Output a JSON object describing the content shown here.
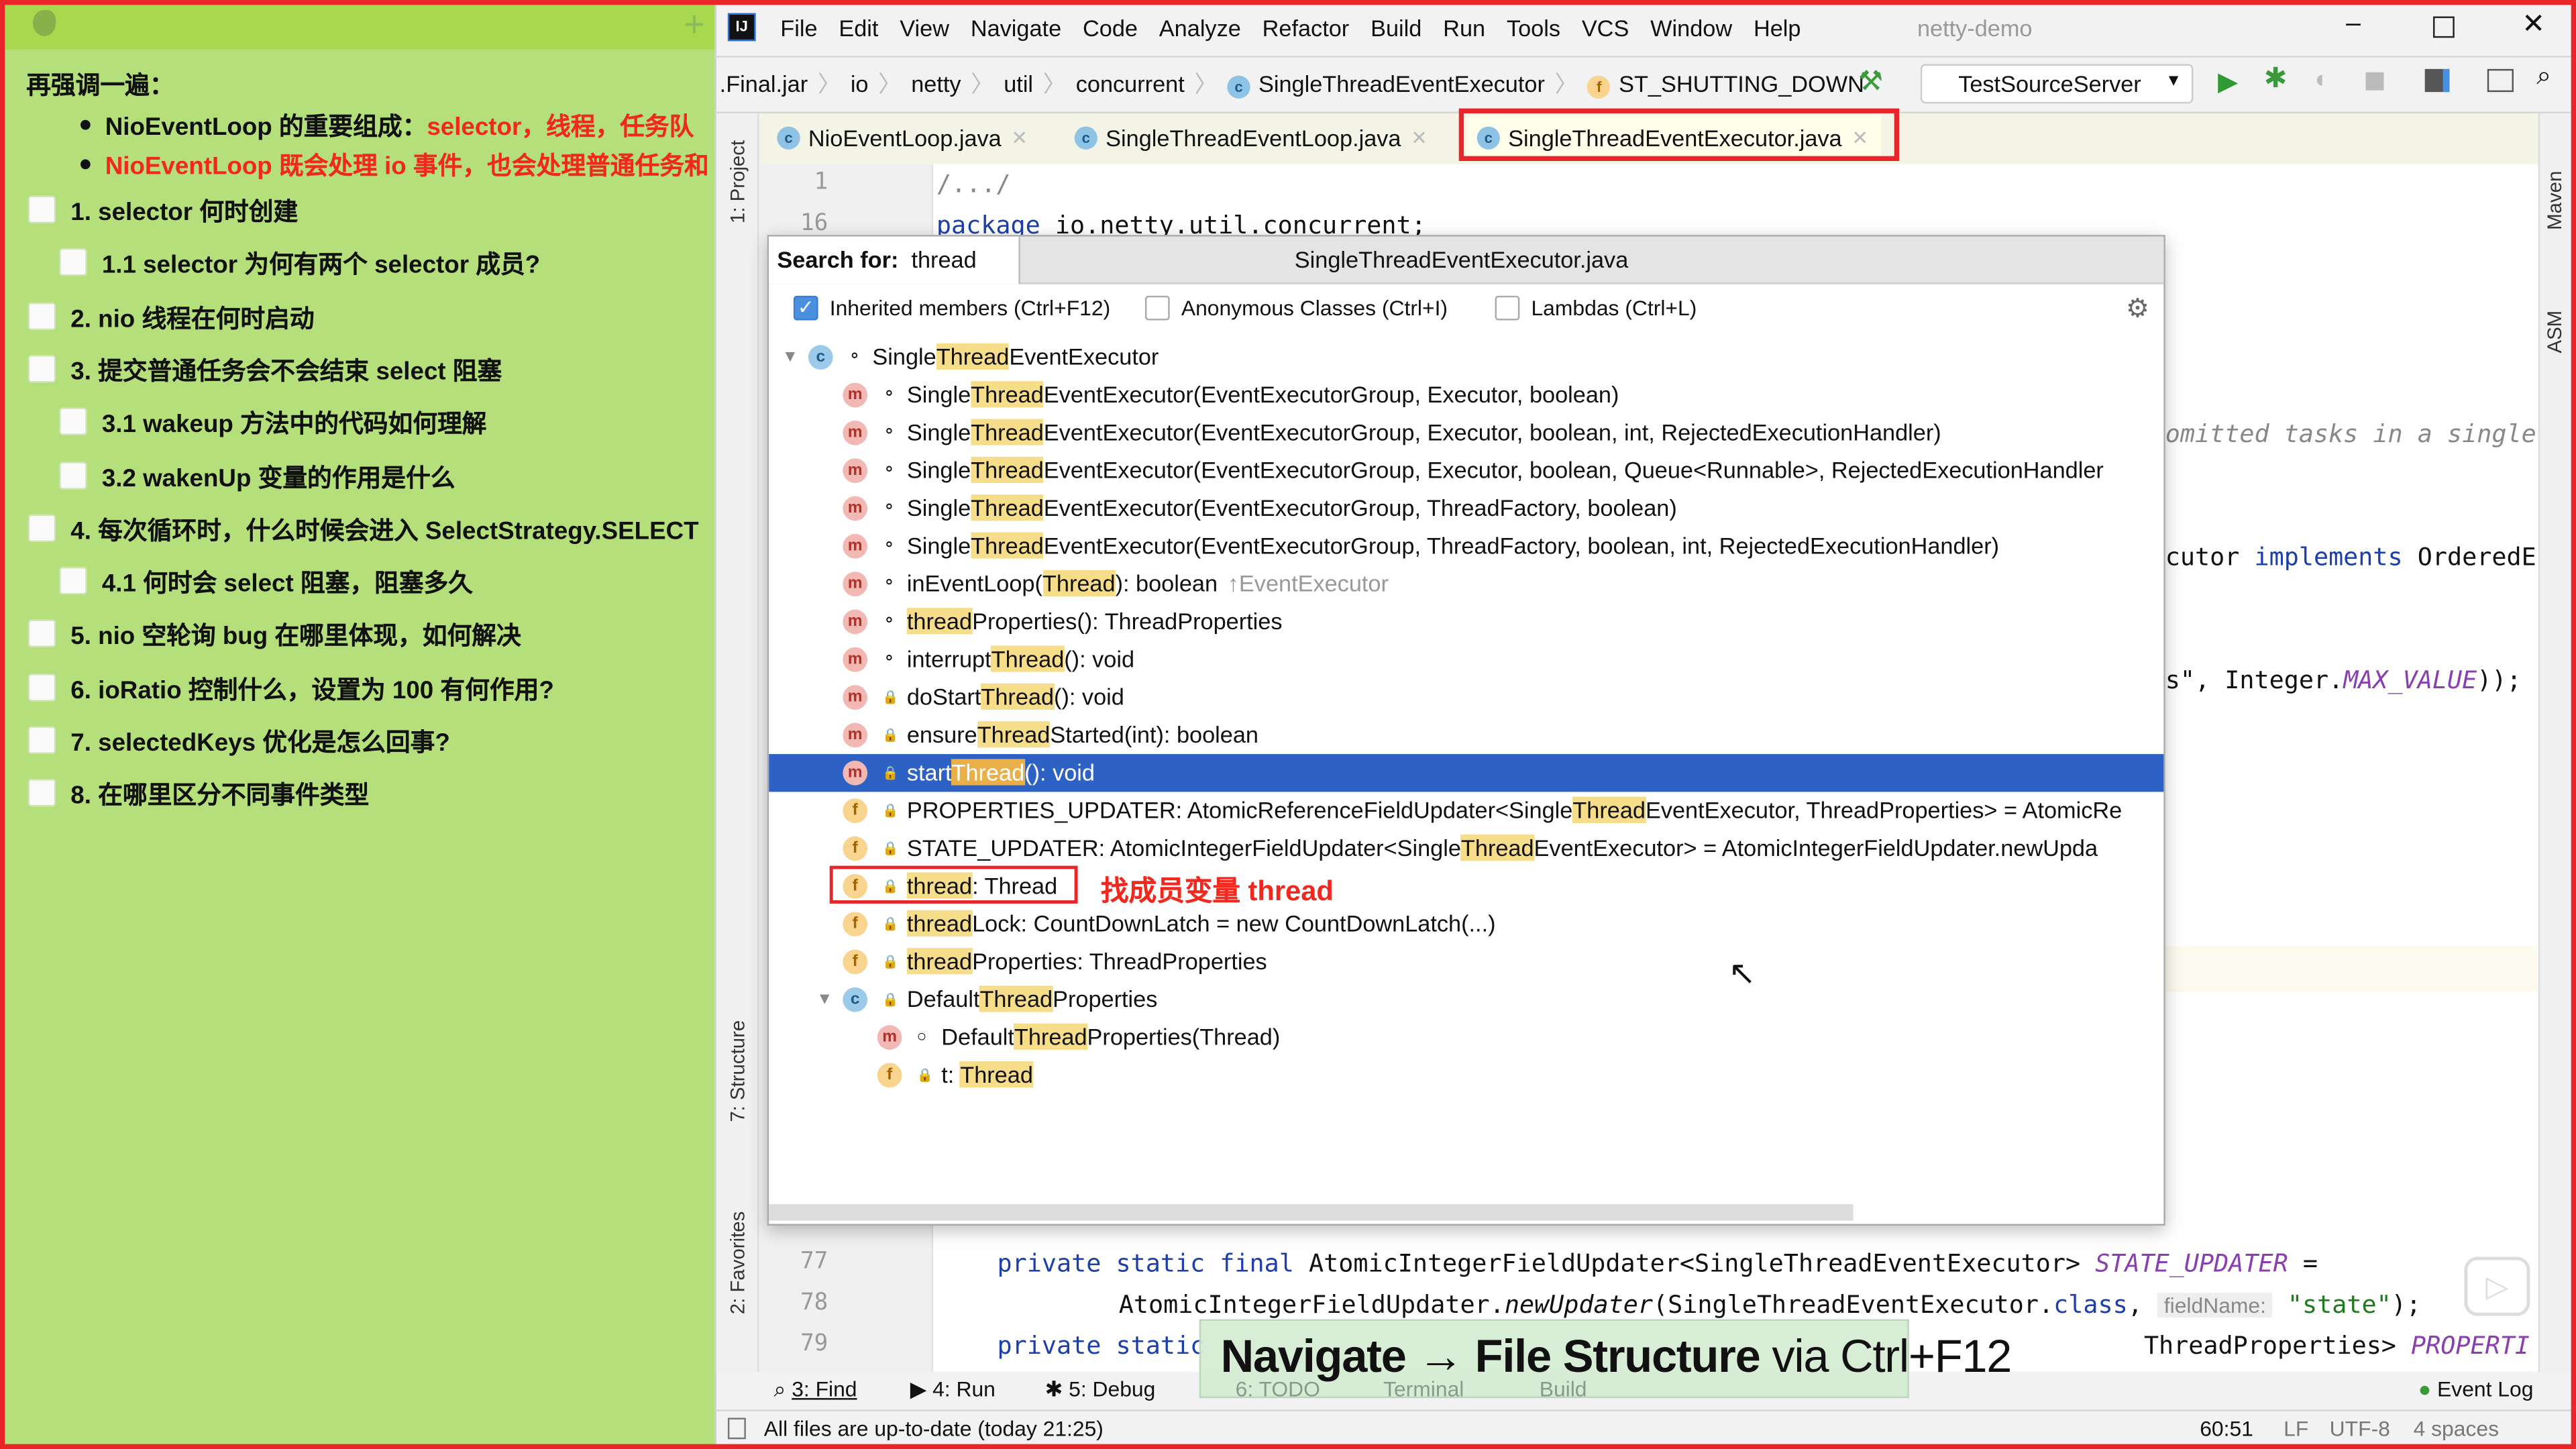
{
  "notes": {
    "heading": "再强调一遍：",
    "bullets": [
      {
        "pre": "NioEventLoop 的重要组成：",
        "red": "selector，线程，任务队"
      },
      {
        "pre": "",
        "red": "NioEventLoop 既会处理 io 事件，也会处理普通任务和"
      }
    ],
    "items": [
      {
        "label": "1. selector 何时创建",
        "level": 0,
        "checked": false
      },
      {
        "label": "1.1 selector 为何有两个 selector 成员?",
        "level": 1,
        "checked": false
      },
      {
        "label": "2. nio 线程在何时启动",
        "level": 0,
        "checked": false
      },
      {
        "label": "3. 提交普通任务会不会结束 select 阻塞",
        "level": 0,
        "checked": false
      },
      {
        "label": "3.1 wakeup 方法中的代码如何理解",
        "level": 1,
        "checked": false
      },
      {
        "label": "3.2 wakenUp 变量的作用是什么",
        "level": 1,
        "checked": false
      },
      {
        "label": "4. 每次循环时，什么时候会进入 SelectStrategy.SELECT",
        "level": 0,
        "checked": false
      },
      {
        "label": "4.1 何时会 select 阻塞，阻塞多久",
        "level": 1,
        "checked": false
      },
      {
        "label": "5. nio 空轮询 bug 在哪里体现，如何解决",
        "level": 0,
        "checked": false
      },
      {
        "label": "6. ioRatio 控制什么，设置为 100 有何作用?",
        "level": 0,
        "checked": false
      },
      {
        "label": "7. selectedKeys 优化是怎么回事?",
        "level": 0,
        "checked": false
      },
      {
        "label": "8. 在哪里区分不同事件类型",
        "level": 0,
        "checked": false
      }
    ]
  },
  "ide": {
    "menu": [
      "File",
      "Edit",
      "View",
      "Navigate",
      "Code",
      "Analyze",
      "Refactor",
      "Build",
      "Run",
      "Tools",
      "VCS",
      "Window",
      "Help"
    ],
    "project_name": "netty-demo",
    "breadcrumb": [
      ".Final.jar",
      "io",
      "netty",
      "util",
      "concurrent",
      "SingleThreadEventExecutor",
      "ST_SHUTTING_DOWN"
    ],
    "run_config": "TestSourceServer",
    "tabs": [
      {
        "label": "NioEventLoop.java",
        "active": false
      },
      {
        "label": "SingleThreadEventLoop.java",
        "active": false
      },
      {
        "label": "SingleThreadEventExecutor.java",
        "active": true
      }
    ],
    "side_left": [
      "1: Project",
      "7: Structure",
      "2: Favorites"
    ],
    "side_right": [
      "Maven",
      "ASM"
    ],
    "code": {
      "line1_no": "1",
      "line1": "/.../",
      "line16_no": "16",
      "line16_kw": "package",
      "line16": " io.netty.util.concurrent;",
      "frag_comment": "omitted tasks in a single",
      "frag_impl_a": "cutor ",
      "frag_impl_kw": "implements",
      "frag_impl_b": " OrderedE",
      "frag_max_a": "s\", Integer.",
      "frag_max_it": "MAX_VALUE",
      "frag_max_b": "));",
      "l77_no": "77",
      "l77_kw": "private static final",
      "l77_a": " AtomicIntegerFieldUpdater<SingleThreadEventExecutor> ",
      "l77_it": "STATE_UPDATER",
      "l77_b": " =",
      "l78_no": "78",
      "l78_a": "AtomicIntegerFieldUpdater.",
      "l78_it": "newUpdater",
      "l78_b": "(SingleThreadEventExecutor.",
      "l78_kw": "class",
      "l78_c": ", ",
      "l78_hint": "fieldName:",
      "l78_str": "\"state\"",
      "l78_d": ");",
      "l79_no": "79",
      "l79_kw": "private static",
      "l79_a": " ThreadProperties> ",
      "l79_it": "PROPERTI"
    },
    "popup": {
      "search_label": "Search for:",
      "search_value": "thread",
      "file_name": "SingleThreadEventExecutor.java",
      "options": [
        {
          "label": "Inherited members (Ctrl+F12)",
          "checked": true
        },
        {
          "label": "Anonymous Classes (Ctrl+I)",
          "checked": false
        },
        {
          "label": "Lambdas (Ctrl+L)",
          "checked": false
        }
      ],
      "rows": [
        {
          "level": 0,
          "kind": "c",
          "vis": "public",
          "expanded": true,
          "pre": "Single",
          "match": "Thread",
          "post": "EventExecutor"
        },
        {
          "level": 1,
          "kind": "m",
          "vis": "protected",
          "pre": "Single",
          "match": "Thread",
          "post": "EventExecutor(EventExecutorGroup, Executor, boolean)"
        },
        {
          "level": 1,
          "kind": "m",
          "vis": "protected",
          "pre": "Single",
          "match": "Thread",
          "post": "EventExecutor(EventExecutorGroup, Executor, boolean, int, RejectedExecutionHandler)"
        },
        {
          "level": 1,
          "kind": "m",
          "vis": "protected",
          "pre": "Single",
          "match": "Thread",
          "post": "EventExecutor(EventExecutorGroup, Executor, boolean, Queue<Runnable>, RejectedExecutionHandler"
        },
        {
          "level": 1,
          "kind": "m",
          "vis": "protected",
          "pre": "Single",
          "match": "Thread",
          "post": "EventExecutor(EventExecutorGroup, ThreadFactory, boolean)"
        },
        {
          "level": 1,
          "kind": "m",
          "vis": "protected",
          "pre": "Single",
          "match": "Thread",
          "post": "EventExecutor(EventExecutorGroup, ThreadFactory, boolean, int, RejectedExecutionHandler)"
        },
        {
          "level": 1,
          "kind": "m",
          "vis": "public",
          "pre": "inEventLoop(",
          "match": "Thread",
          "post": "): boolean",
          "suffix": "↑EventExecutor"
        },
        {
          "level": 1,
          "kind": "m",
          "vis": "public",
          "pre": "",
          "match": "thread",
          "post": "Properties(): ThreadProperties"
        },
        {
          "level": 1,
          "kind": "m",
          "vis": "protected",
          "pre": "interrupt",
          "match": "Thread",
          "post": "(): void"
        },
        {
          "level": 1,
          "kind": "m",
          "vis": "private",
          "pre": "doStart",
          "match": "Thread",
          "post": "(): void"
        },
        {
          "level": 1,
          "kind": "m",
          "vis": "private",
          "pre": "ensure",
          "match": "Thread",
          "post": "Started(int): boolean"
        },
        {
          "level": 1,
          "kind": "m",
          "vis": "private",
          "pre": "start",
          "match": "Thread",
          "post": "(): void",
          "selected": true
        },
        {
          "level": 1,
          "kind": "f",
          "vis": "private",
          "pre": "PROPERTIES_UPDATER: AtomicReferenceFieldUpdater<Single",
          "match": "Thread",
          "post": "EventExecutor, ThreadProperties> = AtomicRe"
        },
        {
          "level": 1,
          "kind": "f",
          "vis": "private",
          "pre": "STATE_UPDATER: AtomicIntegerFieldUpdater<Single",
          "match": "Thread",
          "post": "EventExecutor> = AtomicIntegerFieldUpdater.newUpda"
        },
        {
          "level": 1,
          "kind": "f",
          "vis": "private",
          "pre": "",
          "match": "thread",
          "post": ": Thread",
          "annotated": true
        },
        {
          "level": 1,
          "kind": "f",
          "vis": "private",
          "pre": "",
          "match": "thread",
          "post": "Lock: CountDownLatch = new CountDownLatch(...)"
        },
        {
          "level": 1,
          "kind": "f",
          "vis": "private",
          "pre": "",
          "match": "thread",
          "post": "Properties: ThreadProperties"
        },
        {
          "level": 1,
          "kind": "c",
          "vis": "private",
          "expanded": true,
          "pre": "Default",
          "match": "Thread",
          "post": "Properties"
        },
        {
          "level": 2,
          "kind": "m",
          "vis": "package",
          "pre": "Default",
          "match": "Thread",
          "post": "Properties(Thread)"
        },
        {
          "level": 2,
          "kind": "f",
          "vis": "private",
          "pre": "t: ",
          "match": "Thread",
          "post": ""
        }
      ]
    },
    "annotation": "找成员变量 thread",
    "bottom_tools": [
      "3: Find",
      "4: Run",
      "5: Debug",
      "6: TODO",
      "Terminal",
      "Build"
    ],
    "event_log": "Event Log",
    "status": {
      "message": "All files are up-to-date (today 21:25)",
      "position": "60:51",
      "line_sep": "LF",
      "encoding": "UTF-8",
      "indent": "4 spaces"
    }
  },
  "caption": {
    "bold": "Navigate → File Structure",
    "rest": " via Ctrl+F12"
  },
  "colors": {
    "frame": "#e8262a",
    "notes_bg": "#b5df7a",
    "selection": "#2d62c4",
    "match_highlight": "#f6dd8a",
    "annotation": "#f0281e"
  }
}
